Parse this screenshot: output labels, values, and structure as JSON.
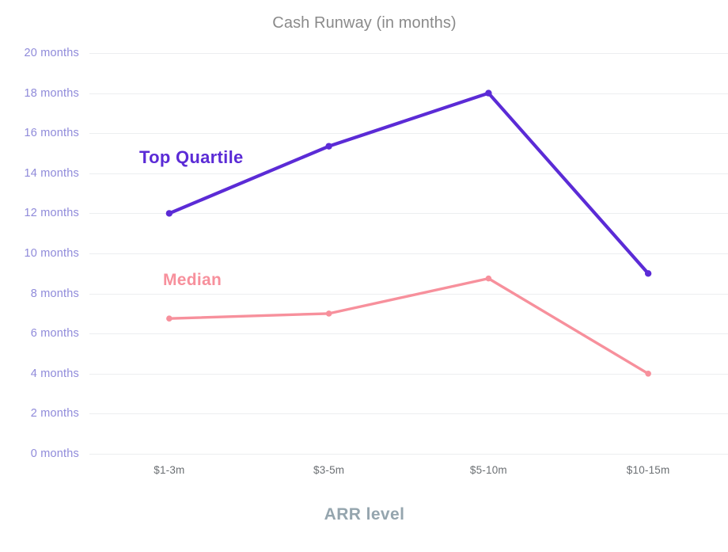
{
  "chart_data": {
    "type": "line",
    "title": "Cash Runway (in months)",
    "xlabel": "ARR level",
    "ylabel": "",
    "categories": [
      "$1-3m",
      "$3-5m",
      "$5-10m",
      "$10-15m"
    ],
    "series": [
      {
        "name": "Top Quartile",
        "color": "#5b2bd6",
        "values": [
          12,
          15.35,
          18,
          9
        ]
      },
      {
        "name": "Median",
        "color": "#f7909c",
        "values": [
          6.75,
          7,
          8.75,
          4
        ]
      }
    ],
    "ylim": [
      0,
      20
    ],
    "ytick_step": 2,
    "ytick_labels": [
      "20 months",
      "18 months",
      "16 months",
      "14 months",
      "12 months",
      "10 months",
      "8 months",
      "6 months",
      "4 months",
      "2 months",
      "0 months"
    ],
    "ytick_values": [
      20,
      18,
      16,
      14,
      12,
      10,
      8,
      6,
      4,
      2,
      0
    ],
    "grid": true,
    "legend_position": "inline-annotations",
    "colors": {
      "top_quartile": "#5b2bd6",
      "median": "#f7909c",
      "gridline": "#eceef0",
      "y_axis_label": "#8f8ada",
      "x_axis_label": "#6b6f73",
      "x_axis_title": "#95a5ae",
      "title": "#8a8a8a",
      "background": "#ffffff"
    }
  }
}
